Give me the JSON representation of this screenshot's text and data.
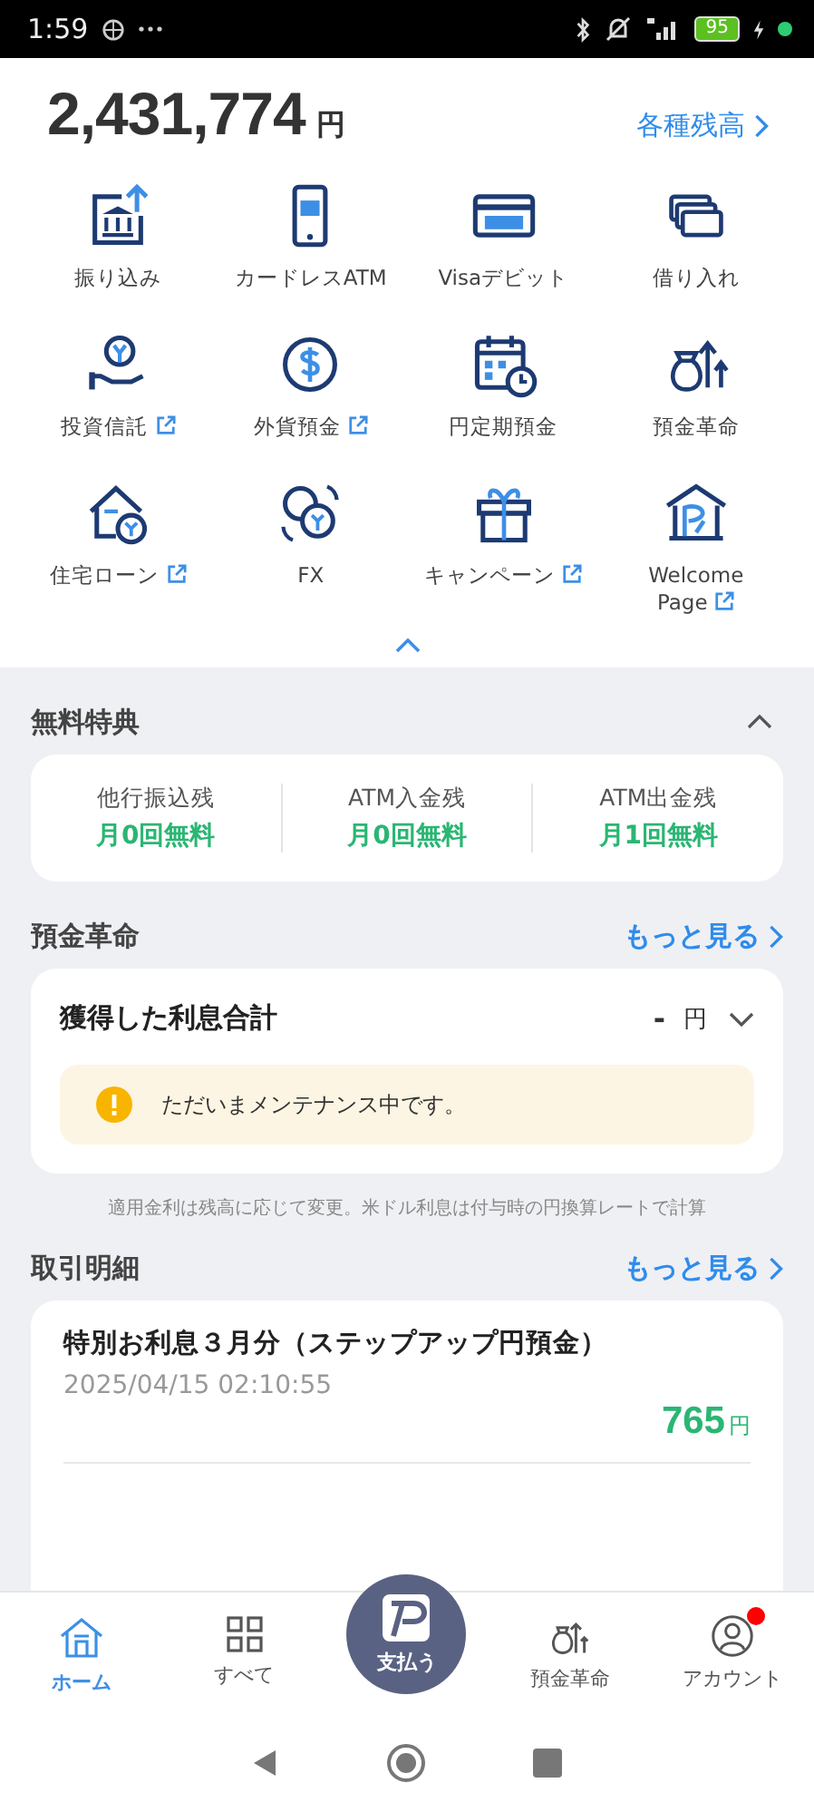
{
  "status_bar": {
    "time": "1:59",
    "battery": "95"
  },
  "balance": {
    "amount": "2,431,774",
    "unit": "円",
    "link": "各種残高"
  },
  "menu": [
    {
      "label": "振り込み",
      "external": false
    },
    {
      "label": "カードレスATM",
      "external": false
    },
    {
      "label": "Visaデビット",
      "external": false
    },
    {
      "label": "借り入れ",
      "external": false
    },
    {
      "label": "投資信託",
      "external": true
    },
    {
      "label": "外貨預金",
      "external": true
    },
    {
      "label": "円定期預金",
      "external": false
    },
    {
      "label": "預金革命",
      "external": false
    },
    {
      "label": "住宅ローン",
      "external": true
    },
    {
      "label": "FX",
      "external": false
    },
    {
      "label": "キャンペーン",
      "external": true
    },
    {
      "label": "Welcome Page",
      "external": true
    }
  ],
  "free_benefits": {
    "title": "無料特典",
    "expanded": true,
    "items": [
      {
        "label": "他行振込残",
        "value": "月0回無料"
      },
      {
        "label": "ATM入金残",
        "value": "月0回無料"
      },
      {
        "label": "ATM出金残",
        "value": "月1回無料"
      }
    ]
  },
  "deposit_revolution": {
    "title": "預金革命",
    "more": "もっと見る",
    "card_title": "獲得した利息合計",
    "amount": "-",
    "unit": "円",
    "notice": "ただいまメンテナンス中です。",
    "footnote": "適用金利は残高に応じて変更。米ドル利息は付与時の円換算レートで計算"
  },
  "transactions": {
    "title": "取引明細",
    "more": "もっと見る",
    "items": [
      {
        "title": "特別お利息３月分（ステップアップ円預金）",
        "date": "2025/04/15 02:10:55",
        "amount": "765",
        "unit": "円"
      }
    ]
  },
  "bottom_nav": [
    {
      "kind": "tab",
      "label": "ホーム",
      "selected": true,
      "badge": false
    },
    {
      "kind": "tab",
      "label": "すべて",
      "selected": false,
      "badge": false
    },
    {
      "kind": "pay",
      "label": "支払う",
      "selected": false
    },
    {
      "kind": "tab",
      "label": "預金革命",
      "selected": false,
      "badge": false
    },
    {
      "kind": "tab",
      "label": "アカウント",
      "selected": false,
      "badge": true
    }
  ]
}
